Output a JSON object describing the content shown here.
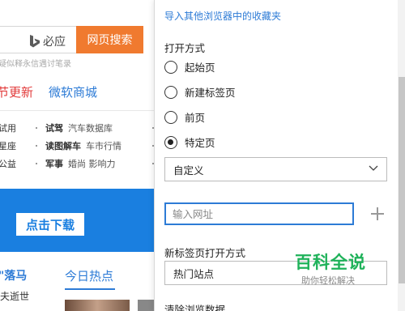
{
  "background_page": {
    "bing_label": "必应",
    "search_button": "网页搜索",
    "hint": "疑似释永信遇讨笔录",
    "link_red": "节更新",
    "link_blue": "微软商城",
    "grid": {
      "col1": [
        "试用",
        "星座",
        "公益"
      ],
      "col2": [
        {
          "bold": "试驾",
          "sub": "汽车数据库"
        },
        {
          "bold": "读图解车",
          "sub": "车市行情"
        },
        {
          "bold": "军事",
          "sub": "婚尚  影响力"
        }
      ]
    },
    "banner_button": "点击下载",
    "news_left": "\"落马",
    "news_left2": "夫逝世",
    "hot_tab": "今日热点"
  },
  "settings": {
    "import_link": "导入其他浏览器中的收藏夹",
    "open_with_title": "打开方式",
    "radio_options": [
      {
        "label": "起始页",
        "checked": false
      },
      {
        "label": "新建标签页",
        "checked": false
      },
      {
        "label": "前页",
        "checked": false
      },
      {
        "label": "特定页",
        "checked": true
      }
    ],
    "custom_select": "自定义",
    "url_placeholder": "输入网址",
    "newtab_title": "新标签页打开方式",
    "newtab_select": "热门站点",
    "clear_title": "清除浏览数据"
  },
  "watermark": {
    "title": "百科全说",
    "subtitle": "助你轻松解决"
  },
  "colors": {
    "accent": "#2d7bd6",
    "search_button": "#f07a2f",
    "banner": "#1a7fe0",
    "watermark": "#1fb25a"
  },
  "icons": [
    "bing-logo-icon",
    "chevron-down-icon",
    "plus-icon"
  ]
}
